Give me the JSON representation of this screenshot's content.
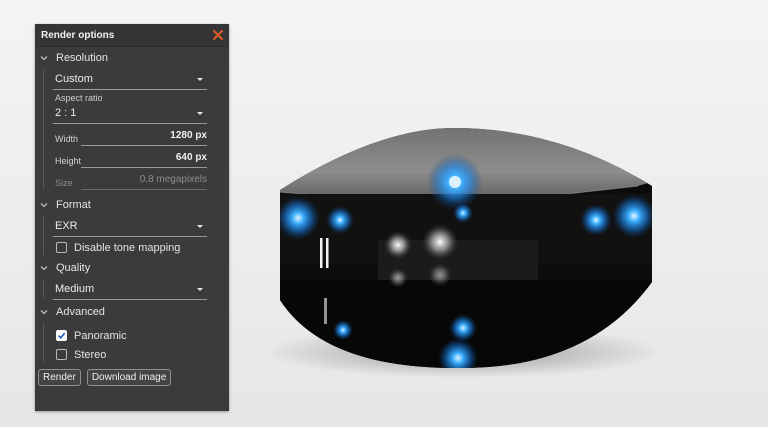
{
  "panel": {
    "title": "Render options"
  },
  "icons": {
    "close": "close-icon",
    "chevron": "chevron-down-icon",
    "check": "check-icon"
  },
  "colors": {
    "close_accent": "#e35b2a",
    "panel_bg": "#3b3b3b",
    "glow": "#2aa0ff"
  },
  "resolution": {
    "label": "Resolution",
    "preset": "Custom",
    "aspect_label": "Aspect ratio",
    "aspect_value": "2 : 1",
    "width_label": "Width",
    "width_value": "1280 px",
    "height_label": "Height",
    "height_value": "640 px",
    "size_label": "Size",
    "size_value": "0.8 megapixels"
  },
  "format": {
    "label": "Format",
    "value": "EXR",
    "disable_tone_mapping": {
      "label": "Disable tone mapping",
      "checked": false
    }
  },
  "quality": {
    "label": "Quality",
    "value": "Medium"
  },
  "advanced": {
    "label": "Advanced",
    "panoramic": {
      "label": "Panoramic",
      "checked": true
    },
    "stereo": {
      "label": "Stereo",
      "checked": false
    }
  },
  "buttons": {
    "render": "Render",
    "download": "Download image"
  }
}
